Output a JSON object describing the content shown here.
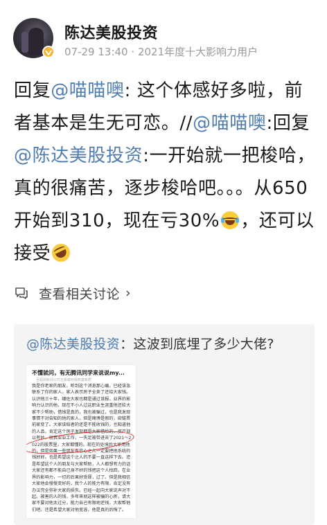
{
  "user": {
    "name": "陈达美股投资",
    "date": "07-29 13:40",
    "separator": "·",
    "honor": "2021年度十大影响力用户"
  },
  "post": {
    "seg1": "回复",
    "mention1": "@喵喵噢",
    "seg2": ": 这个体感好多啦，前者基本是生无可恋。//",
    "mention2": "@喵喵噢",
    "seg3": ":回复",
    "mention3": "@陈达美股投资",
    "seg4": ":一开始就一把梭哈，真的很痛苦，逐步梭哈吧。。。从650开始到310，现在亏30%",
    "seg5": "，还可以接受"
  },
  "related": {
    "label": "查看相关讨论",
    "chevron": "›"
  },
  "repost": {
    "mention": "@陈达美股投资",
    "text": "：这波到底埋了多少大佬?"
  },
  "thumbnail": {
    "title": "不懂就问，有无腾讯同学来说说my...",
    "subtitle": "互联网新闻公司五颜缤纷隔热套新质",
    "body": "我是你老家的朋友，听到这个消息那心痛，已经该急联系了你的家人，家人表示房子全卖了还给大家钱。认识他三十年，细佐大家也都是通过该报，业界的影响力认识的他，现在不小人过这职业生涯重他还给大家不少帮助，借钱是真的，我也被骗过，也是我发现事情不对告知的他的家人，但是赌博是假的，欲拔票前家变了。大家该赔者的还是不能收钱的，也知道他的人品，肯定这个房子发现都是大家借给的，资产部以有妙，就我业业工作，一失足被带进去了2021～2022的股票里，大家都懂的。现在的处境后大家用他的，但是如果一些朋友有信心之人一定要把他系统的钱好好。也是希望这个之人的不要一直这样下去。还是希望这个人的朋友与大家帮助，人人都想有力的话大家还有都不能自己身不好的钱把这个人找回，在业界的影响力，一切的后果好受罪，过了。但是我相信大家他会慢慢变好的，我个人的能力有限，肯定没有办法完全弥补大家的损失。已经一起向大家说声对不起。被害的人的钱，多年来就这样被骗的心疼，请大家不要对他太过分，能力自己有限地还钱，大家帮他们吧。还是希望大家对他宽容，他是真的后悔了。"
  },
  "colors": {
    "mention": "#507daf",
    "meta": "#9a9a9a",
    "badge": "#f6b532",
    "repost_bg": "#f4f4f4",
    "annotation_red": "#d8231a"
  },
  "icons": {
    "badge": "verified-badge-icon",
    "related": "comment-discussion-icon",
    "emoji1": "laughing-tears-emoji-icon",
    "emoji2": "rolling-laugh-emoji-icon"
  }
}
